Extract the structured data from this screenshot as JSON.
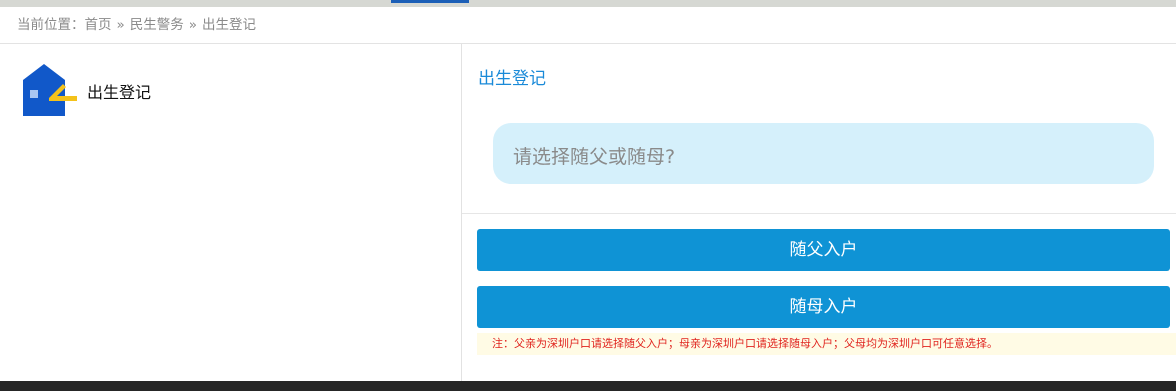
{
  "breadcrumb": {
    "prefix": "当前位置：",
    "items": [
      "首页",
      "民生警务",
      "出生登记"
    ],
    "separator": "»"
  },
  "left_panel": {
    "icon": "house-icon",
    "title": "出生登记"
  },
  "right_panel": {
    "title": "出生登记",
    "question": "请选择随父或随母?",
    "buttons": {
      "father": "随父入户",
      "mother": "随母入户"
    },
    "note": "注：父亲为深圳户口请选择随父入户；母亲为深圳户口请选择随母入户；父母均为深圳户口可任意选择。"
  },
  "colors": {
    "button": "#0f93d5",
    "title": "#1a8ad8",
    "question_bg": "#d5f0fb",
    "note_text": "#e0241e",
    "note_bg": "#fffbe5"
  }
}
